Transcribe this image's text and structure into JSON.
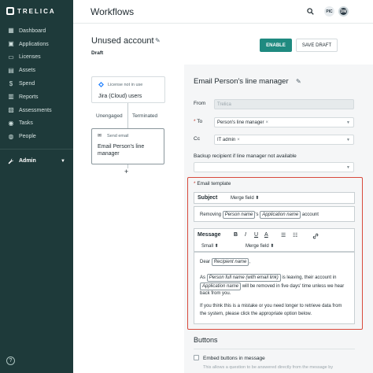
{
  "app": {
    "name": "TRELICA"
  },
  "sidebar": {
    "items": [
      {
        "label": "Dashboard",
        "icon": "dashboard-icon",
        "glyph": "▦"
      },
      {
        "label": "Applications",
        "icon": "applications-icon",
        "glyph": "▣"
      },
      {
        "label": "Licenses",
        "icon": "licenses-icon",
        "glyph": "▭"
      },
      {
        "label": "Assets",
        "icon": "assets-icon",
        "glyph": "▤"
      },
      {
        "label": "Spend",
        "icon": "spend-icon",
        "glyph": "$"
      },
      {
        "label": "Reports",
        "icon": "reports-icon",
        "glyph": "▥"
      },
      {
        "label": "Assessments",
        "icon": "assessments-icon",
        "glyph": "▧"
      },
      {
        "label": "Tasks",
        "icon": "tasks-icon",
        "glyph": "◉"
      },
      {
        "label": "People",
        "icon": "people-icon",
        "glyph": "◍"
      }
    ],
    "admin": {
      "label": "Admin",
      "icon": "wrench-icon"
    },
    "help": "?"
  },
  "header": {
    "title": "Workflows",
    "avatars": [
      "PIC",
      "DM"
    ]
  },
  "workflow": {
    "title": "Unused account",
    "status": "Draft",
    "enable_label": "ENABLE",
    "save_label": "SAVE DRAFT"
  },
  "canvas": {
    "trigger": {
      "label": "License not in use",
      "title": "Jira (Cloud) users"
    },
    "branch_left": "Unengaged",
    "branch_right": "Terminated",
    "action": {
      "label": "Send email",
      "title_line1": "Email Person's line",
      "title_line2": "manager"
    },
    "add": "+"
  },
  "panel": {
    "title": "Email Person's line manager",
    "from_label": "From",
    "from_value": "Trelica",
    "to_label": "To",
    "to_chip": "Person's line manager",
    "cc_label": "Cc",
    "cc_chip": "IT admin",
    "backup_label": "Backup recipient if line manager not available",
    "template_label": "Email template",
    "subject_label": "Subject",
    "merge_field": "Merge field",
    "subject_parts": {
      "pre": "Removing",
      "f1": "Person name",
      "mid": "'s",
      "f2": "Application name",
      "post": "account"
    },
    "message_label": "Message",
    "toolbar": {
      "bold": "B",
      "italic": "I",
      "underline": "U",
      "color": "A",
      "ul": "☰",
      "ol": "☷",
      "link": "🔗",
      "size": "Small"
    },
    "body": {
      "dear": "Dear",
      "recipient": "Recipient name",
      "as": "As",
      "person_email": "Person full name (with email link)",
      "leaving": "is leaving, their account in",
      "app": "Application name",
      "removed": "will be removed in five days' time unless we hear",
      "back": "back from you.",
      "mistake1": "If you think this is a mistake or you need longer to retrieve data from",
      "mistake2": "the system, please click the appropriate option below."
    },
    "buttons_heading": "Buttons",
    "embed_label": "Embed buttons in message",
    "embed_hint": "This allows a question to be answered directly from the message by"
  }
}
